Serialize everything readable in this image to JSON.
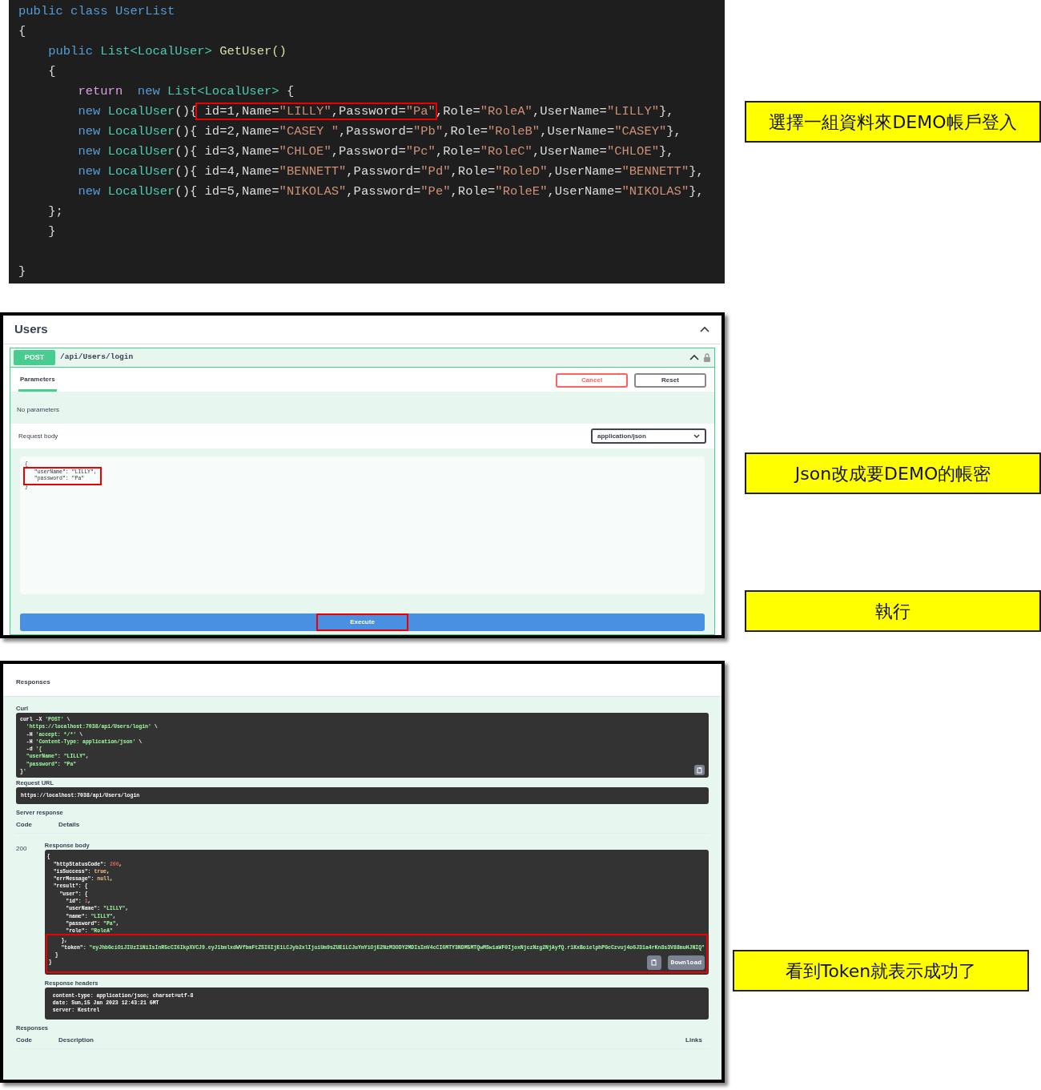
{
  "code_panel": {
    "lines": [
      {
        "tokens": [
          {
            "text": "public class ",
            "kind": "keyword"
          },
          {
            "text": "UserList",
            "kind": "keyword"
          }
        ]
      },
      {
        "tokens": [
          {
            "text": "{",
            "kind": "plain"
          }
        ]
      },
      {
        "tokens": [
          {
            "text": "    public ",
            "kind": "keyword"
          },
          {
            "text": "List<LocalUser>",
            "kind": "type"
          },
          {
            "text": " GetUser()",
            "kind": "method"
          }
        ]
      },
      {
        "tokens": [
          {
            "text": "    {",
            "kind": "plain"
          }
        ]
      },
      {
        "tokens": [
          {
            "text": "        return  ",
            "kind": "control"
          },
          {
            "text": "new ",
            "kind": "keyword"
          },
          {
            "text": "List<LocalUser>",
            "kind": "type"
          },
          {
            "text": " {",
            "kind": "plain"
          }
        ]
      },
      {
        "tokens": [
          {
            "text": "        new ",
            "kind": "keyword"
          },
          {
            "text": "LocalUser",
            "kind": "type"
          },
          {
            "text": "(){",
            "kind": "plain"
          },
          {
            "text": " id=1,Name=",
            "kind": "plain",
            "boxed": true
          },
          {
            "text": "\"LILLY\"",
            "kind": "string",
            "boxed": true
          },
          {
            "text": ",Password=",
            "kind": "plain",
            "boxed": true
          },
          {
            "text": "\"Pa\"",
            "kind": "string",
            "boxed": true
          },
          {
            "text": ",Role=",
            "kind": "plain"
          },
          {
            "text": "\"RoleA\"",
            "kind": "string"
          },
          {
            "text": ",UserName=",
            "kind": "plain"
          },
          {
            "text": "\"LILLY\"",
            "kind": "string"
          },
          {
            "text": "},",
            "kind": "plain"
          }
        ]
      },
      {
        "tokens": [
          {
            "text": "        new ",
            "kind": "keyword"
          },
          {
            "text": "LocalUser",
            "kind": "type"
          },
          {
            "text": "(){ id=2,Name=",
            "kind": "plain"
          },
          {
            "text": "\"CASEY \"",
            "kind": "string"
          },
          {
            "text": ",Password=",
            "kind": "plain"
          },
          {
            "text": "\"Pb\"",
            "kind": "string"
          },
          {
            "text": ",Role=",
            "kind": "plain"
          },
          {
            "text": "\"RoleB\"",
            "kind": "string"
          },
          {
            "text": ",UserName=",
            "kind": "plain"
          },
          {
            "text": "\"CASEY\"",
            "kind": "string"
          },
          {
            "text": "},",
            "kind": "plain"
          }
        ]
      },
      {
        "tokens": [
          {
            "text": "        new ",
            "kind": "keyword"
          },
          {
            "text": "LocalUser",
            "kind": "type"
          },
          {
            "text": "(){ id=3,Name=",
            "kind": "plain"
          },
          {
            "text": "\"CHLOE\"",
            "kind": "string"
          },
          {
            "text": ",Password=",
            "kind": "plain"
          },
          {
            "text": "\"Pc\"",
            "kind": "string"
          },
          {
            "text": ",Role=",
            "kind": "plain"
          },
          {
            "text": "\"RoleC\"",
            "kind": "string"
          },
          {
            "text": ",UserName=",
            "kind": "plain"
          },
          {
            "text": "\"CHLOE\"",
            "kind": "string"
          },
          {
            "text": "},",
            "kind": "plain"
          }
        ]
      },
      {
        "tokens": [
          {
            "text": "        new ",
            "kind": "keyword"
          },
          {
            "text": "LocalUser",
            "kind": "type"
          },
          {
            "text": "(){ id=4,Name=",
            "kind": "plain"
          },
          {
            "text": "\"BENNETT\"",
            "kind": "string"
          },
          {
            "text": ",Password=",
            "kind": "plain"
          },
          {
            "text": "\"Pd\"",
            "kind": "string"
          },
          {
            "text": ",Role=",
            "kind": "plain"
          },
          {
            "text": "\"RoleD\"",
            "kind": "string"
          },
          {
            "text": ",UserName=",
            "kind": "plain"
          },
          {
            "text": "\"BENNETT\"",
            "kind": "string"
          },
          {
            "text": "},",
            "kind": "plain"
          }
        ]
      },
      {
        "tokens": [
          {
            "text": "        new ",
            "kind": "keyword"
          },
          {
            "text": "LocalUser",
            "kind": "type"
          },
          {
            "text": "(){ id=5,Name=",
            "kind": "plain"
          },
          {
            "text": "\"NIKOLAS\"",
            "kind": "string"
          },
          {
            "text": ",Password=",
            "kind": "plain"
          },
          {
            "text": "\"Pe\"",
            "kind": "string"
          },
          {
            "text": ",Role=",
            "kind": "plain"
          },
          {
            "text": "\"RoleE\"",
            "kind": "string"
          },
          {
            "text": ",UserName=",
            "kind": "plain"
          },
          {
            "text": "\"NIKOLAS\"",
            "kind": "string"
          },
          {
            "text": "},",
            "kind": "plain"
          }
        ]
      },
      {
        "tokens": [
          {
            "text": "    };",
            "kind": "plain"
          }
        ]
      },
      {
        "tokens": [
          {
            "text": "    }",
            "kind": "plain"
          }
        ]
      },
      {
        "tokens": [
          {
            "text": "}",
            "kind": "plain"
          }
        ]
      }
    ],
    "callouts": [
      {
        "text": "選擇一組資料來DEMO帳戶登入"
      }
    ]
  },
  "request_panel": {
    "section_title": "Users",
    "method": "POST",
    "path": "/api/Users/login",
    "tabs": [
      {
        "label": "Parameters",
        "selected": true
      }
    ],
    "buttons": [
      {
        "label": "Cancel",
        "kind": "cancel"
      },
      {
        "label": "Reset",
        "kind": "reset"
      }
    ],
    "no_params": "No parameters",
    "request_body_label": "Request body",
    "content_type": "application/json",
    "body_lines": [
      {
        "text": "{",
        "boxed": false
      },
      {
        "text": "  \"userName\": \"LILLY\",",
        "boxed": true
      },
      {
        "text": "  \"password\": \"Pa\"",
        "boxed": true
      },
      {
        "text": "}",
        "boxed": false
      }
    ],
    "execute": {
      "label": "Execute",
      "boxed": true
    },
    "callouts": [
      {
        "text": "Json改成要DEMO的帳密"
      },
      {
        "text": "執行"
      }
    ]
  },
  "response_panel": {
    "title": "Responses",
    "curl_label": "Curl",
    "curl_lines": [
      "curl -X 'POST' \\",
      "  'https://localhost:7038/api/Users/login' \\",
      "  -H 'accept: */*' \\",
      "  -H 'Content-Type: application/json' \\",
      "  -d '{",
      "  \"userName\": \"LILLY\",",
      "  \"password\": \"Pa\"",
      "}'"
    ],
    "request_url_label": "Request URL",
    "request_url": "https://localhost:7038/api/Users/login",
    "server_response_label": "Server response",
    "columns": [
      "Code",
      "Details"
    ],
    "status_code": "200",
    "response_body_label": "Response body",
    "body_lines": [
      "{",
      "  \"httpStatusCode\": 200,",
      "  \"isSuccess\": true,",
      "  \"errMessage\": null,",
      "  \"result\": {",
      "    \"user\": {",
      "      \"id\": 1,",
      "      \"userName\": \"LILLY\",",
      "      \"name\": \"LILLY\",",
      "      \"password\": \"Pa\",",
      "      \"role\": \"RoleA\""
    ],
    "highlighted_lines": [
      "    },",
      "    \"token\": \"eyJhbGciOiJIUzI1NiIsInR5cCI6IkpXVCJ9.eyJ1bmlxdWVfbmFtZSI6IjE1LCJyb2xlIjoiUm9sZUE1LCJuYmYiOjE2NzM3ODY2MDIsImV4cCI6MTY3NDM5MTQwMSwiaWF0IjoxNjczNzg2NjAyfQ.r1KxBoielphPGcCzvuj4oGJ31a4rKn8s3V88muHJNIQ\"",
      "  }",
      "}"
    ],
    "download": "Download",
    "response_headers_label": "Response headers",
    "header_lines": [
      "content-type: application/json; charset=utf-8",
      "date: Sun,15 Jan 2023 12:43:21 GMT",
      "server: Kestrel"
    ],
    "responses_label": "Responses",
    "responses_columns": [
      "Code",
      "Description",
      "Links"
    ],
    "callouts": [
      {
        "text": "看到Token就表示成功了"
      }
    ]
  }
}
